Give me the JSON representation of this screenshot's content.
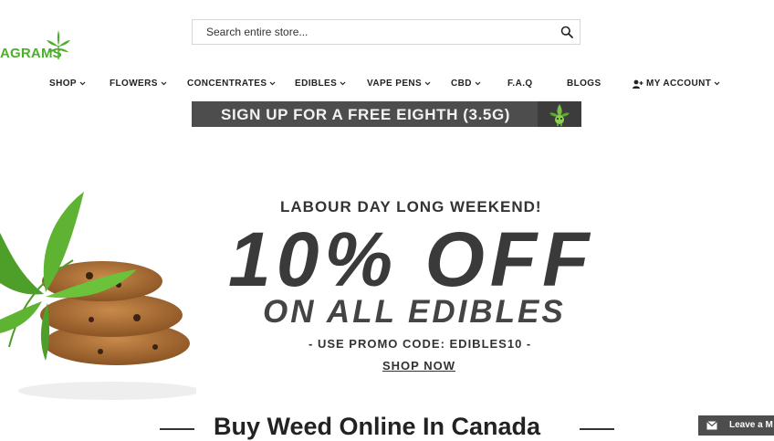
{
  "header": {
    "logo_text": "AGRAMS",
    "search": {
      "placeholder": "Search entire store..."
    }
  },
  "nav": {
    "items": [
      {
        "label": "SHOP",
        "has_dropdown": true
      },
      {
        "label": "FLOWERS",
        "has_dropdown": true
      },
      {
        "label": "CONCENTRATES",
        "has_dropdown": true
      },
      {
        "label": "EDIBLES",
        "has_dropdown": true
      },
      {
        "label": "VAPE PENS",
        "has_dropdown": true
      },
      {
        "label": "CBD",
        "has_dropdown": true
      },
      {
        "label": "F.A.Q",
        "has_dropdown": false
      },
      {
        "label": "BLOGS",
        "has_dropdown": false
      },
      {
        "label": "MY ACCOUNT",
        "has_dropdown": true,
        "icon": "user-plus-icon"
      }
    ]
  },
  "promo_banner": {
    "text": "SIGN UP FOR A FREE EIGHTH (3.5G)",
    "icon": "cannabis-mascot-icon"
  },
  "hero": {
    "line1": "LABOUR DAY LONG WEEKEND!",
    "discount": "10% OFF",
    "subline": "ON ALL EDIBLES",
    "promo_code": "- USE PROMO CODE: EDIBLES10 -",
    "cta": "SHOP NOW"
  },
  "section": {
    "title": "Buy Weed Online In Canada"
  },
  "chat_widget": {
    "label": "Leave a M",
    "icon": "envelope-icon"
  },
  "colors": {
    "brand_green": "#4caf2a",
    "banner_gray": "#4d4d4d"
  }
}
